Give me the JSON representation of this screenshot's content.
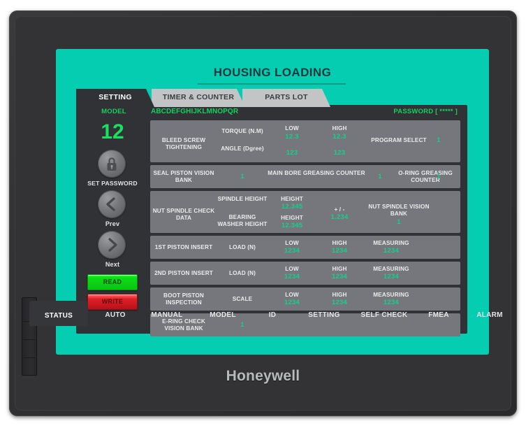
{
  "screen": {
    "title": "HOUSING LOADING"
  },
  "tabs": [
    {
      "label": "SETTING",
      "active": true
    },
    {
      "label": "TIMER & COUNTER",
      "active": false
    },
    {
      "label": "PARTS LOT",
      "active": false
    }
  ],
  "header": {
    "model_label": "MODEL",
    "code": "ABCDEFGHIJKLMNOPQR",
    "password": "PASSWORD [ ***** ]"
  },
  "sidebar": {
    "model_value": "12",
    "set_password_label": "SET PASSWORD",
    "prev_label": "Prev",
    "next_label": "Next",
    "read_label": "READ",
    "write_label": "WRITE",
    "icons": {
      "lock": "lock-icon",
      "prev": "chevron-left-icon",
      "next": "chevron-right-icon"
    }
  },
  "table": {
    "rows": [
      {
        "name": "BLEED SCREW TIGHTENING",
        "sub1": "TORQUE (N.M)",
        "sub2": "ANGLE (Dgree)",
        "low_label": "LOW",
        "high_label": "HIGH",
        "low1": "12.3",
        "high1": "12.3",
        "low2": "123",
        "high2": "123",
        "right_label": "PROGRAM SELECT",
        "right_value": "1"
      },
      {
        "name": "SEAL PISTON VISION BANK",
        "value1": "1",
        "mid_label": "MAIN BORE GREASING COUNTER",
        "mid_value": "1",
        "right_label": "O-RING GREASING COUNTER",
        "right_value": "1"
      },
      {
        "name": "NUT SPINDLE CHECK DATA",
        "sub1": "SPINDLE HEIGHT",
        "sub2": "BEARING WASHER HEIGHT",
        "h1_label": "HEIGHT",
        "h1_value": "12.345",
        "h2_label": "HEIGHT",
        "h2_value": "12.345",
        "tol_label": "+ / -",
        "tol_value": "1.234",
        "right_label": "NUT SPINDLE VISION BANK",
        "right_value": "1"
      },
      {
        "name": "1ST PISTON INSERT",
        "sub1": "LOAD (N)",
        "low_label": "LOW",
        "high_label": "HIGH",
        "meas_label": "MEASURING",
        "low1": "1234",
        "high1": "1234",
        "meas1": "1234"
      },
      {
        "name": "2ND PISTON INSERT",
        "sub1": "LOAD (N)",
        "low_label": "LOW",
        "high_label": "HIGH",
        "meas_label": "MEASURING",
        "low1": "1234",
        "high1": "1234",
        "meas1": "1234"
      },
      {
        "name": "BOOT PISTON INSPECTION",
        "sub1": "SCALE",
        "low_label": "LOW",
        "high_label": "HIGH",
        "meas_label": "MEASURING",
        "low1": "1234",
        "high1": "1234",
        "meas1": "1234"
      },
      {
        "name": "E-RING CHECK VISION BANK",
        "value1": "1"
      }
    ]
  },
  "navbar": {
    "items": [
      {
        "label": "STATUS",
        "active": true
      },
      {
        "label": "AUTO",
        "active": false
      },
      {
        "label": "MANUAL",
        "active": false
      },
      {
        "label": "MODEL",
        "active": false
      },
      {
        "label": "ID",
        "active": false
      },
      {
        "label": "SETTING",
        "active": false
      },
      {
        "label": "SELF CHECK",
        "active": false
      },
      {
        "label": "FMEA",
        "active": false
      },
      {
        "label": "ALARM",
        "active": false
      }
    ]
  },
  "brand": {
    "name": "Honeywell"
  },
  "colors": {
    "screen_teal": "#04cdb1",
    "panel_dark": "#313235",
    "row_gray": "#76777c",
    "value_green": "#12d18a",
    "label_green": "#17cf5e",
    "read_green": "#0bdf16",
    "write_red": "#e01f28",
    "indicator_green": "#25ef45"
  }
}
